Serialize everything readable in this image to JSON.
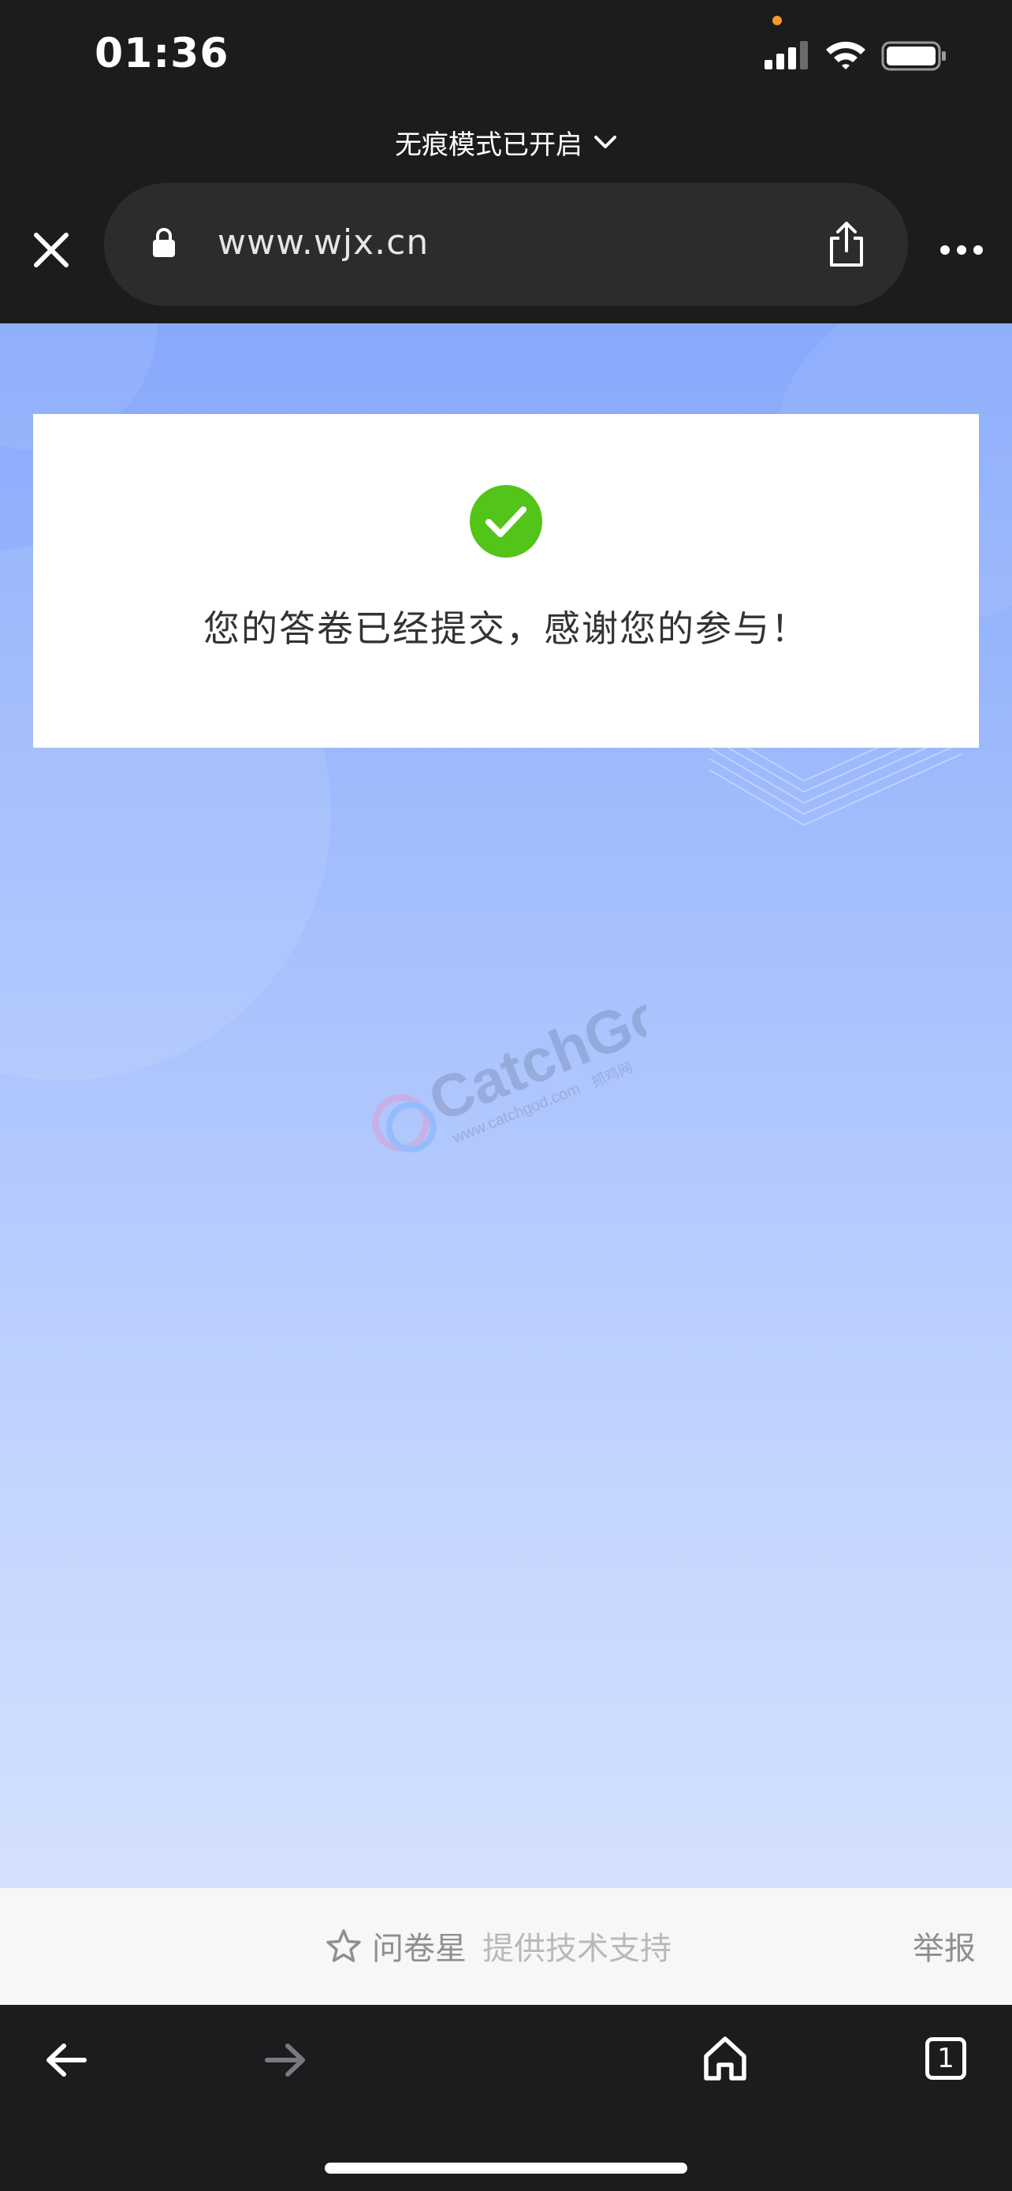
{
  "status_bar": {
    "time": "01:36",
    "icons": [
      "signal-bars-icon",
      "wifi-icon",
      "battery-icon"
    ],
    "privacy_indicator_color": "#f29a2e"
  },
  "browser": {
    "incognito_label": "无痕模式已开启",
    "url": "www.wjx.cn",
    "icons": [
      "close-icon",
      "lock-icon",
      "share-icon",
      "more-icon"
    ]
  },
  "page": {
    "message": "您的答卷已经提交，感谢您的参与！",
    "success_color": "#52c41a",
    "watermark": {
      "brand": "CatchGod",
      "url": "www.catchgod.com",
      "cn": "抓鸡网"
    },
    "footer": {
      "brand": "问卷星",
      "support": "提供技术支持",
      "report": "举报"
    }
  },
  "bottom_bar": {
    "tab_count": "1",
    "icons": [
      "back-arrow-icon",
      "forward-arrow-icon",
      "home-icon",
      "tabs-icon"
    ]
  },
  "colors": {
    "chrome_background": "#1c1c1e",
    "address_pill": "#2c2c2e",
    "page_gradient_top": "#87a9fb",
    "page_gradient_bottom": "#d3e0fe"
  }
}
